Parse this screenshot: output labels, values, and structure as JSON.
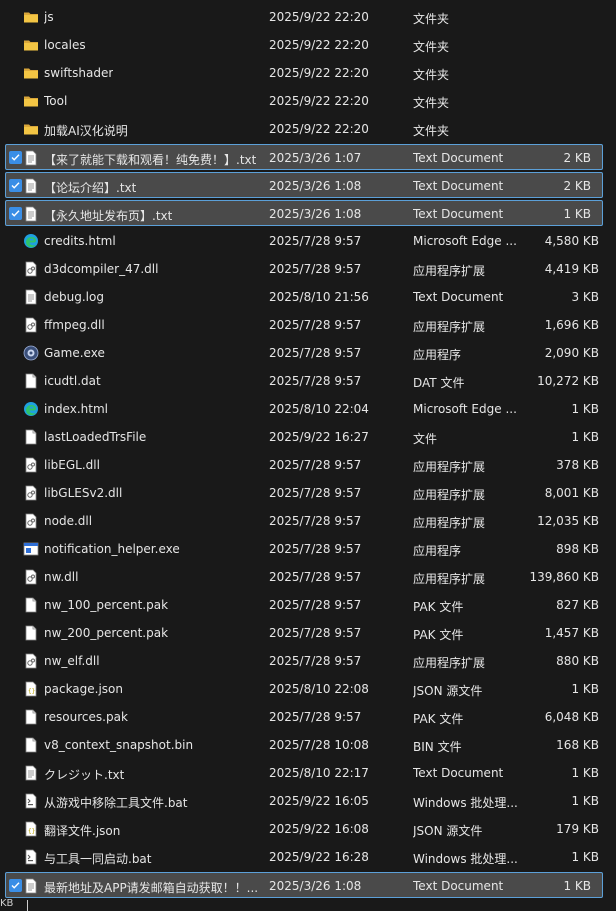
{
  "files": [
    {
      "name": "js",
      "date": "2025/9/22 22:20",
      "type": "文件夹",
      "size": "",
      "icon": "folder-icon",
      "selected": false
    },
    {
      "name": "locales",
      "date": "2025/9/22 22:20",
      "type": "文件夹",
      "size": "",
      "icon": "folder-icon",
      "selected": false
    },
    {
      "name": "swiftshader",
      "date": "2025/9/22 22:20",
      "type": "文件夹",
      "size": "",
      "icon": "folder-icon",
      "selected": false
    },
    {
      "name": "Tool",
      "date": "2025/9/22 22:20",
      "type": "文件夹",
      "size": "",
      "icon": "folder-icon",
      "selected": false
    },
    {
      "name": "加载AI汉化说明",
      "date": "2025/9/22 22:20",
      "type": "文件夹",
      "size": "",
      "icon": "folder-icon",
      "selected": false
    },
    {
      "name": "【来了就能下载和观看！纯免费！】.txt",
      "date": "2025/3/26 1:07",
      "type": "Text Document",
      "size": "2 KB",
      "icon": "text-file-icon",
      "selected": true
    },
    {
      "name": "【论坛介绍】.txt",
      "date": "2025/3/26 1:08",
      "type": "Text Document",
      "size": "2 KB",
      "icon": "text-file-icon",
      "selected": true
    },
    {
      "name": "【永久地址发布页】.txt",
      "date": "2025/3/26 1:08",
      "type": "Text Document",
      "size": "1 KB",
      "icon": "text-file-icon",
      "selected": true
    },
    {
      "name": "credits.html",
      "date": "2025/7/28 9:57",
      "type": "Microsoft Edge ...",
      "size": "4,580 KB",
      "icon": "edge-html-icon",
      "selected": false
    },
    {
      "name": "d3dcompiler_47.dll",
      "date": "2025/7/28 9:57",
      "type": "应用程序扩展",
      "size": "4,419 KB",
      "icon": "dll-file-icon",
      "selected": false
    },
    {
      "name": "debug.log",
      "date": "2025/8/10 21:56",
      "type": "Text Document",
      "size": "3 KB",
      "icon": "text-file-icon",
      "selected": false
    },
    {
      "name": "ffmpeg.dll",
      "date": "2025/7/28 9:57",
      "type": "应用程序扩展",
      "size": "1,696 KB",
      "icon": "dll-file-icon",
      "selected": false
    },
    {
      "name": "Game.exe",
      "date": "2025/7/28 9:57",
      "type": "应用程序",
      "size": "2,090 KB",
      "icon": "game-exe-icon",
      "selected": false
    },
    {
      "name": "icudtl.dat",
      "date": "2025/7/28 9:57",
      "type": "DAT 文件",
      "size": "10,272 KB",
      "icon": "blank-file-icon",
      "selected": false
    },
    {
      "name": "index.html",
      "date": "2025/8/10 22:04",
      "type": "Microsoft Edge ...",
      "size": "1 KB",
      "icon": "edge-html-icon",
      "selected": false
    },
    {
      "name": "lastLoadedTrsFile",
      "date": "2025/9/22 16:27",
      "type": "文件",
      "size": "1 KB",
      "icon": "blank-file-icon",
      "selected": false
    },
    {
      "name": "libEGL.dll",
      "date": "2025/7/28 9:57",
      "type": "应用程序扩展",
      "size": "378 KB",
      "icon": "dll-file-icon",
      "selected": false
    },
    {
      "name": "libGLESv2.dll",
      "date": "2025/7/28 9:57",
      "type": "应用程序扩展",
      "size": "8,001 KB",
      "icon": "dll-file-icon",
      "selected": false
    },
    {
      "name": "node.dll",
      "date": "2025/7/28 9:57",
      "type": "应用程序扩展",
      "size": "12,035 KB",
      "icon": "dll-file-icon",
      "selected": false
    },
    {
      "name": "notification_helper.exe",
      "date": "2025/7/28 9:57",
      "type": "应用程序",
      "size": "898 KB",
      "icon": "exe-icon",
      "selected": false
    },
    {
      "name": "nw.dll",
      "date": "2025/7/28 9:57",
      "type": "应用程序扩展",
      "size": "139,860 KB",
      "icon": "dll-file-icon",
      "selected": false
    },
    {
      "name": "nw_100_percent.pak",
      "date": "2025/7/28 9:57",
      "type": "PAK 文件",
      "size": "827 KB",
      "icon": "blank-file-icon",
      "selected": false
    },
    {
      "name": "nw_200_percent.pak",
      "date": "2025/7/28 9:57",
      "type": "PAK 文件",
      "size": "1,457 KB",
      "icon": "blank-file-icon",
      "selected": false
    },
    {
      "name": "nw_elf.dll",
      "date": "2025/7/28 9:57",
      "type": "应用程序扩展",
      "size": "880 KB",
      "icon": "dll-file-icon",
      "selected": false
    },
    {
      "name": "package.json",
      "date": "2025/8/10 22:08",
      "type": "JSON 源文件",
      "size": "1 KB",
      "icon": "json-file-icon",
      "selected": false
    },
    {
      "name": "resources.pak",
      "date": "2025/7/28 9:57",
      "type": "PAK 文件",
      "size": "6,048 KB",
      "icon": "blank-file-icon",
      "selected": false
    },
    {
      "name": "v8_context_snapshot.bin",
      "date": "2025/7/28 10:08",
      "type": "BIN 文件",
      "size": "168 KB",
      "icon": "blank-file-icon",
      "selected": false
    },
    {
      "name": "クレジット.txt",
      "date": "2025/8/10 22:17",
      "type": "Text Document",
      "size": "1 KB",
      "icon": "text-file-icon",
      "selected": false
    },
    {
      "name": "从游戏中移除工具文件.bat",
      "date": "2025/9/22 16:05",
      "type": "Windows 批处理...",
      "size": "1 KB",
      "icon": "bat-file-icon",
      "selected": false
    },
    {
      "name": "翻译文件.json",
      "date": "2025/9/22 16:08",
      "type": "JSON 源文件",
      "size": "179 KB",
      "icon": "json-file-icon",
      "selected": false
    },
    {
      "name": "与工具一同启动.bat",
      "date": "2025/9/22 16:28",
      "type": "Windows 批处理...",
      "size": "1 KB",
      "icon": "bat-file-icon",
      "selected": false
    },
    {
      "name": "最新地址及APP请发邮箱自动获取！！...",
      "date": "2025/3/26 1:08",
      "type": "Text Document",
      "size": "1 KB",
      "icon": "text-file-icon",
      "selected": true
    }
  ],
  "status": {
    "text": "KB"
  },
  "colors": {
    "background": "#191919",
    "selection": "#4a4a4a",
    "selection_border": "#5ca0d8",
    "folder": "#f3c544",
    "checkbox": "#3a8ee6"
  }
}
